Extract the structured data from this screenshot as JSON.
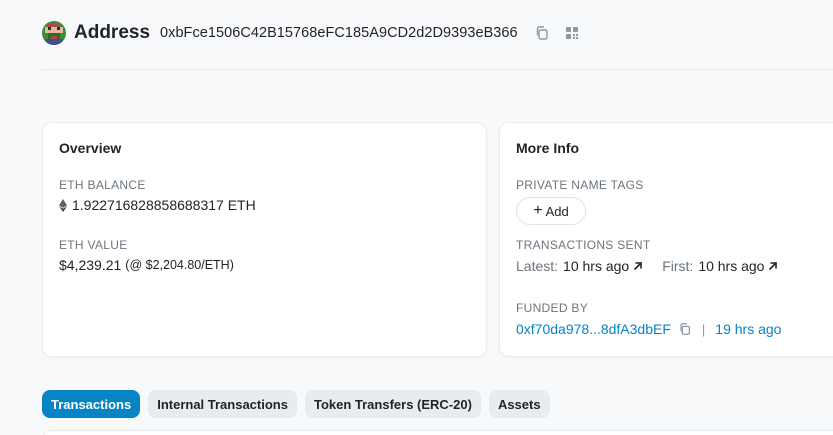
{
  "header": {
    "title": "Address",
    "address": "0xbFce1506C42B15768eFC185A9CD2d2D9393eB366"
  },
  "overview": {
    "title": "Overview",
    "eth_balance_label": "ETH BALANCE",
    "eth_balance_value": "1.922716828858688317 ETH",
    "eth_value_label": "ETH VALUE",
    "eth_value_amount": "$4,239.21",
    "eth_value_rate": "(@ $2,204.80/ETH)"
  },
  "more_info": {
    "title": "More Info",
    "private_tags_label": "PRIVATE NAME TAGS",
    "add_label": "Add",
    "tx_sent_label": "TRANSACTIONS SENT",
    "latest_key": "Latest:",
    "latest_value": "10 hrs ago",
    "first_key": "First:",
    "first_value": "10 hrs ago",
    "funded_by_label": "FUNDED BY",
    "funded_by_address": "0xf70da978...8dfA3dbEF",
    "funded_by_separator": "|",
    "funded_by_time": "19 hrs ago"
  },
  "tabs": [
    {
      "label": "Transactions",
      "active": true
    },
    {
      "label": "Internal Transactions",
      "active": false
    },
    {
      "label": "Token Transfers (ERC-20)",
      "active": false
    },
    {
      "label": "Assets",
      "active": false
    }
  ],
  "icons": {
    "avatar": "identicon-avatar",
    "copy": "copy-icon",
    "qr": "qr-code-icon",
    "eth": "ethereum-icon",
    "arrow": "arrow-up-right-icon"
  },
  "colors": {
    "accent": "#0784c3",
    "muted": "#6c757d",
    "tab_bg": "#e9ecef"
  }
}
